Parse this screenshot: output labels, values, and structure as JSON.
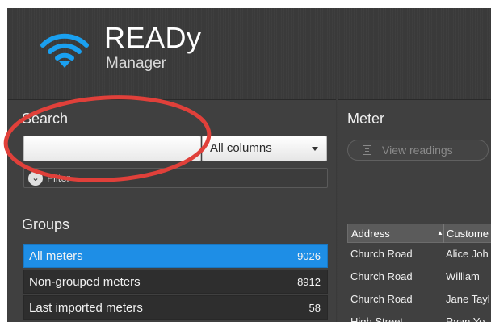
{
  "app": {
    "name": "READy",
    "subtitle": "Manager"
  },
  "colors": {
    "accent": "#1e8ee6",
    "logo": "#1aa0f0",
    "annotation": "#e0403a"
  },
  "search": {
    "title": "Search",
    "input_value": "",
    "column_select": "All columns",
    "filter_label": "Filter"
  },
  "groups": {
    "title": "Groups",
    "items": [
      {
        "label": "All meters",
        "count": "9026",
        "selected": true
      },
      {
        "label": "Non-grouped meters",
        "count": "8912",
        "selected": false
      },
      {
        "label": "Last imported meters",
        "count": "58",
        "selected": false
      }
    ]
  },
  "meter": {
    "title": "Meter",
    "view_readings_label": "View readings",
    "table": {
      "headers": [
        "Address",
        "Custome"
      ],
      "rows": [
        [
          "Church Road",
          "Alice Joh"
        ],
        [
          "Church Road",
          "William"
        ],
        [
          "Church Road",
          "Jane Tayl"
        ],
        [
          "High Street",
          "Ryan Yo"
        ]
      ]
    }
  },
  "icons": {
    "logo": "wifi-signal-icon",
    "filter": "chevron-down-icon",
    "view_readings": "document-icon",
    "sort": "sort-ascending-icon"
  }
}
